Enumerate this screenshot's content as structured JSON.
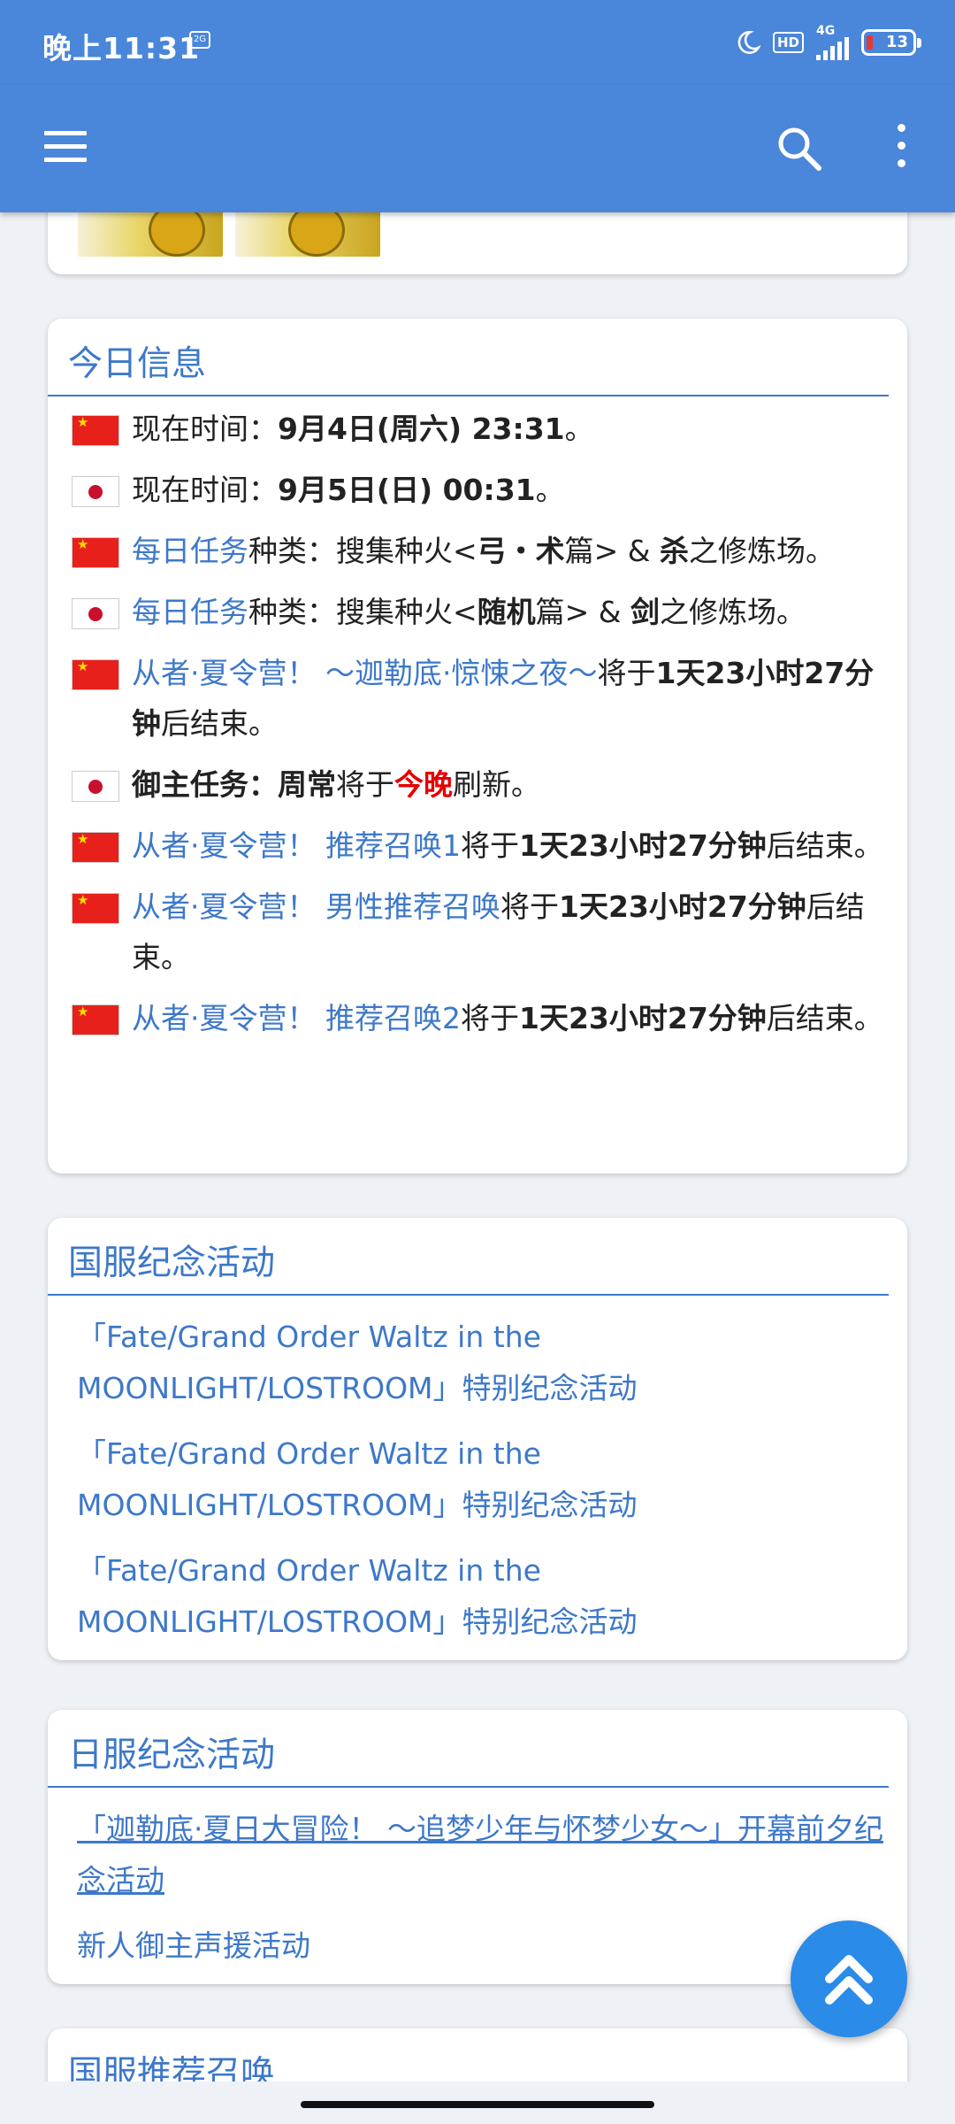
{
  "status_bar": {
    "time": "晚上11:31",
    "badge": "2G",
    "hd": "HD",
    "network": "4G",
    "battery": "13"
  },
  "app_bar": {
    "menu_icon": "hamburger-menu-icon",
    "search_icon": "search-icon",
    "more_icon": "more-vert-icon"
  },
  "today_info": {
    "title": "今日信息",
    "items": [
      {
        "flag": "cn",
        "label": "现在时间：",
        "value": "9月4日(周六) 23:31",
        "suffix": "。"
      },
      {
        "flag": "jp",
        "label": "现在时间：",
        "value": "9月5日(日) 00:31",
        "suffix": "。"
      },
      {
        "flag": "cn",
        "link": "每日任务",
        "text1": "种类：搜集种火<",
        "bold1": "弓・术",
        "text2": "篇> & ",
        "bold2": "杀",
        "text3": "之修炼场。"
      },
      {
        "flag": "jp",
        "link": "每日任务",
        "text1": "种类：搜集种火<",
        "bold1": "随机",
        "text2": "篇> & ",
        "bold2": "剑",
        "text3": "之修炼场。"
      },
      {
        "flag": "cn",
        "link": "从者·夏令营！ ～迦勒底·惊悚之夜～",
        "text1": "将于",
        "bold1": "1天23小时27分钟",
        "text2": "后结束。"
      },
      {
        "flag": "jp",
        "bold0": "御主任务：",
        "bold1": "周常",
        "text1": "将于",
        "red": "今晚",
        "text2": "刷新。"
      },
      {
        "flag": "cn",
        "link": "从者·夏令营！ 推荐召唤1",
        "text1": "将于",
        "bold1": "1天23小时27分钟",
        "text2": "后结束。"
      },
      {
        "flag": "cn",
        "link": "从者·夏令营！ 男性推荐召唤",
        "text1": "将于",
        "bold1": "1天23小时27分钟",
        "text2": "后结束。"
      },
      {
        "flag": "cn",
        "link": "从者·夏令营！ 推荐召唤2",
        "text1": "将于",
        "bold1": "1天23小时27分钟",
        "text2": "后结束。"
      }
    ]
  },
  "cn_events": {
    "title": "国服纪念活动",
    "links": [
      "「Fate/Grand Order Waltz in the MOONLIGHT/LOSTROOM」特别纪念活动",
      "「Fate/Grand Order Waltz in the MOONLIGHT/LOSTROOM」特别纪念活动",
      "「Fate/Grand Order Waltz in the MOONLIGHT/LOSTROOM」特别纪念活动"
    ]
  },
  "jp_events": {
    "title": "日服纪念活动",
    "links": [
      "「迦勒底·夏日大冒险！ ～追梦少年与怀梦少女～」开幕前夕纪念活动",
      "新人御主声援活动"
    ]
  },
  "cn_summon": {
    "title": "国服推荐召唤"
  },
  "fab": {
    "icon": "double-chevron-up-icon"
  },
  "colors": {
    "app_bar": "#4a86d9",
    "link": "#3d78c9",
    "accent_red": "#e50000",
    "fab": "#2b8be8"
  }
}
